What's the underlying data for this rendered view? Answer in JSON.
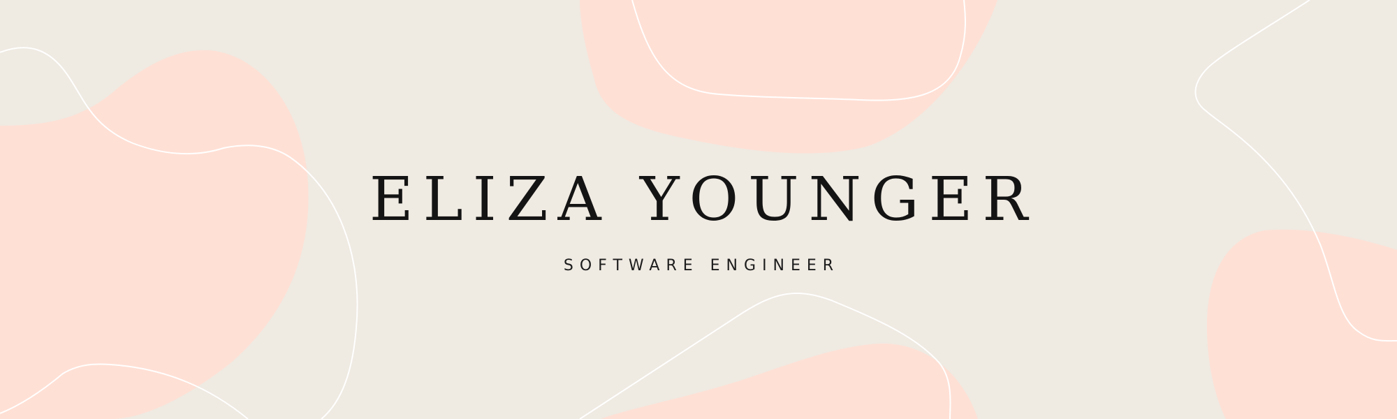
{
  "banner": {
    "name": "ELIZA YOUNGER",
    "subtitle": "SOFTWARE ENGINEER"
  },
  "colors": {
    "background": "#efeae2",
    "blob": "#ffe0d5",
    "line": "#ffffff",
    "text": "#141414"
  }
}
